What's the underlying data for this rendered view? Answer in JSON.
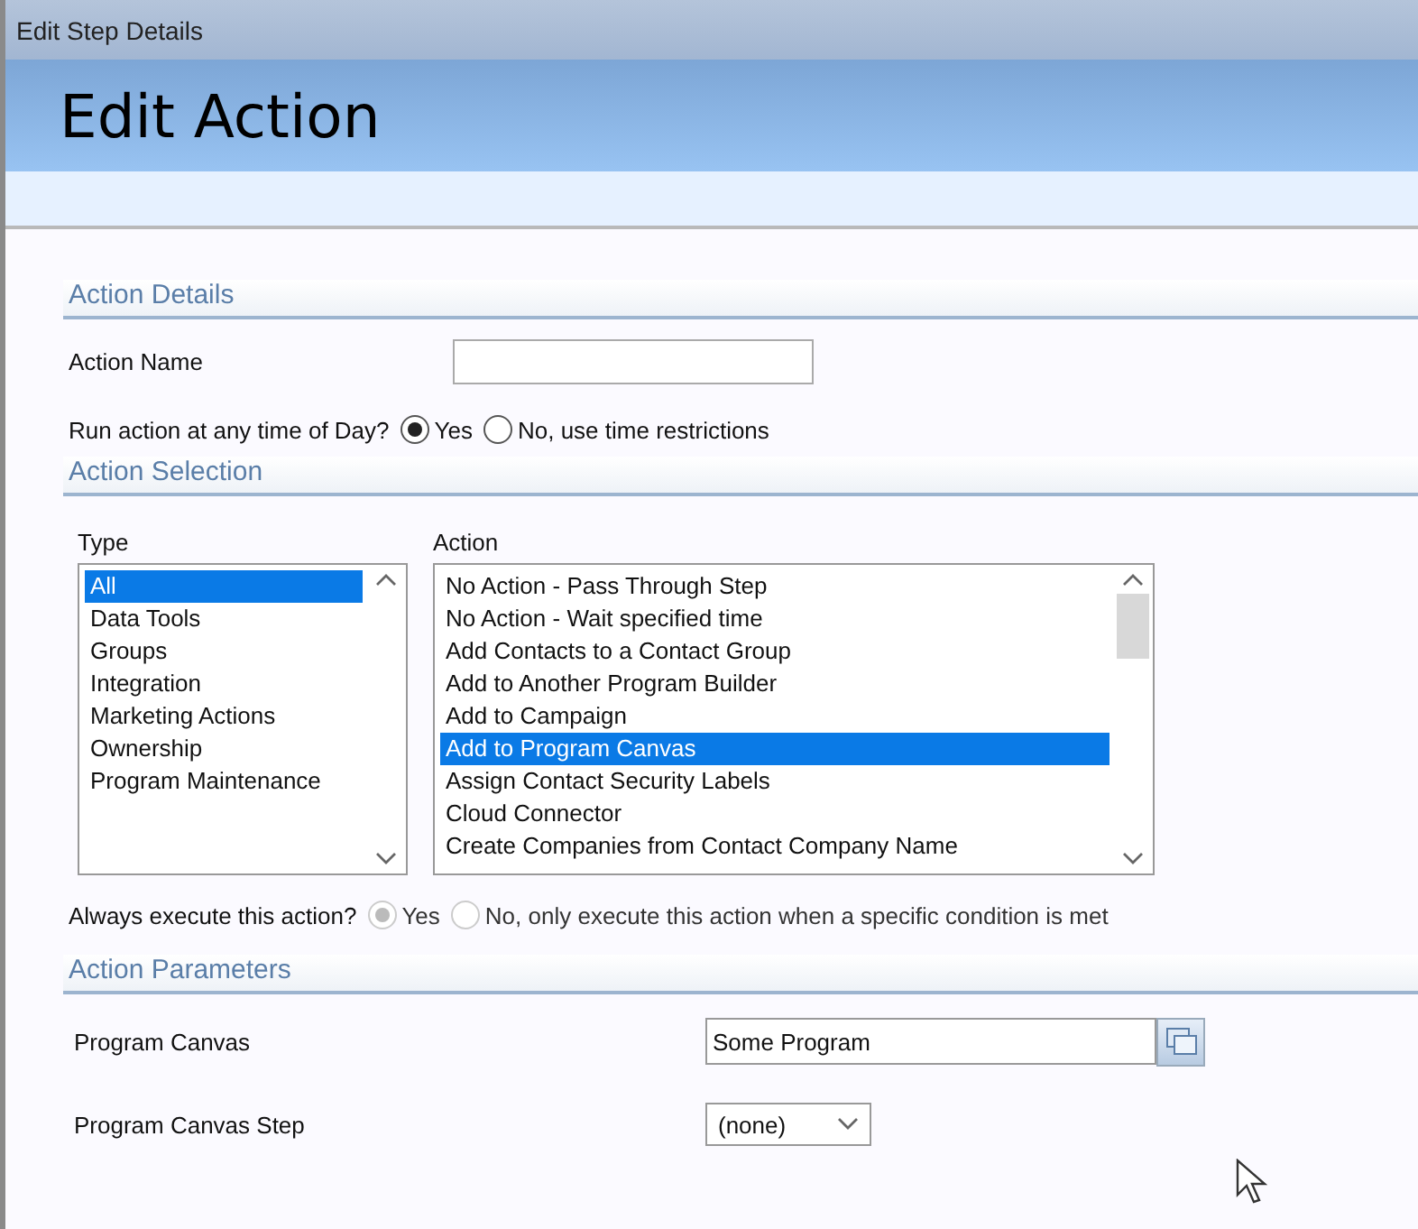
{
  "window": {
    "title": "Edit Step Details"
  },
  "header": {
    "title": "Edit Action"
  },
  "sections": [
    {
      "title": "Action Details"
    },
    {
      "title": "Action Selection"
    },
    {
      "title": "Action Parameters"
    }
  ],
  "action_name": {
    "label": "Action Name"
  },
  "run_any_time": {
    "label": "Run action at any time of Day?",
    "disabled": false,
    "options": [
      {
        "label": "Yes",
        "selected": true
      },
      {
        "label": "No, use time restrictions",
        "selected": false
      }
    ]
  },
  "type_list": {
    "label": "Type",
    "items": [
      {
        "label": "All",
        "selected": true
      },
      {
        "label": "Data Tools",
        "selected": false
      },
      {
        "label": "Groups",
        "selected": false
      },
      {
        "label": "Integration",
        "selected": false
      },
      {
        "label": "Marketing Actions",
        "selected": false
      },
      {
        "label": "Ownership",
        "selected": false
      },
      {
        "label": "Program Maintenance",
        "selected": false
      }
    ]
  },
  "action_list": {
    "label": "Action",
    "items": [
      {
        "label": "No Action - Pass Through Step",
        "selected": false
      },
      {
        "label": "No Action - Wait specified time",
        "selected": false
      },
      {
        "label": "Add Contacts to a Contact Group",
        "selected": false
      },
      {
        "label": "Add to Another Program Builder",
        "selected": false
      },
      {
        "label": "Add to Campaign",
        "selected": false
      },
      {
        "label": "Add to Program Canvas",
        "selected": true
      },
      {
        "label": "Assign Contact Security Labels",
        "selected": false
      },
      {
        "label": "Cloud Connector",
        "selected": false
      },
      {
        "label": "Create Companies from Contact Company Name",
        "selected": false
      }
    ]
  },
  "always_execute": {
    "label": "Always execute this action?",
    "disabled": true,
    "options": [
      {
        "label": "Yes",
        "selected": true
      },
      {
        "label": "No, only execute this action when a specific condition is met",
        "selected": false
      }
    ]
  },
  "parameters": [
    {
      "kind": "lookup",
      "label": "Program Canvas",
      "value": "Some Program"
    },
    {
      "kind": "select",
      "label": "Program Canvas Step",
      "value": "(none)"
    }
  ]
}
